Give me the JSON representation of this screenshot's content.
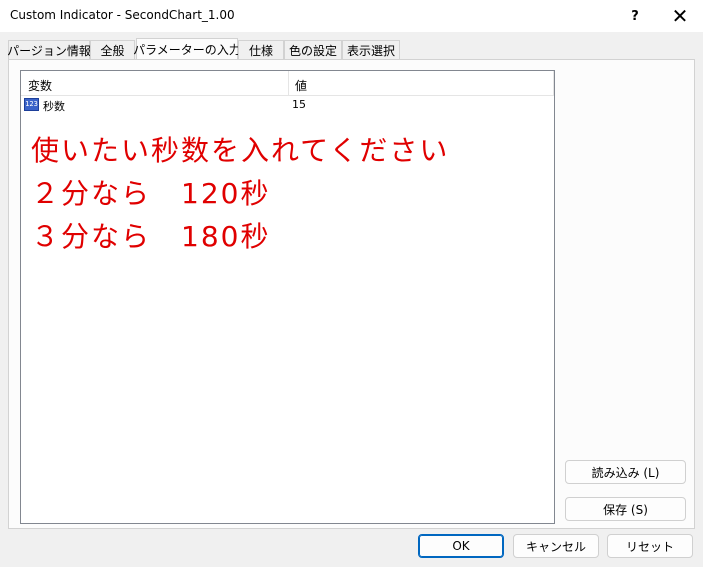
{
  "window": {
    "title": "Custom Indicator - SecondChart_1.00",
    "help_label": "?",
    "close_label": "✕"
  },
  "tabs": [
    {
      "label": "パージョン情報"
    },
    {
      "label": "全般"
    },
    {
      "label": "パラメーターの入力"
    },
    {
      "label": "仕様"
    },
    {
      "label": "色の設定"
    },
    {
      "label": "表示選択"
    }
  ],
  "table": {
    "columns": [
      "変数",
      "値"
    ],
    "rows": [
      {
        "icon_text": "123",
        "name": "秒数",
        "value": "15"
      }
    ]
  },
  "annotation": {
    "lines": [
      "使いたい秒数を入れてください",
      "２分なら　120秒",
      "３分なら　180秒"
    ],
    "color": "#e00000"
  },
  "side_buttons": {
    "load": "読み込み (L)",
    "save": "保存 (S)"
  },
  "footer_buttons": {
    "ok": "OK",
    "cancel": "キャンセル",
    "reset": "リセット"
  }
}
